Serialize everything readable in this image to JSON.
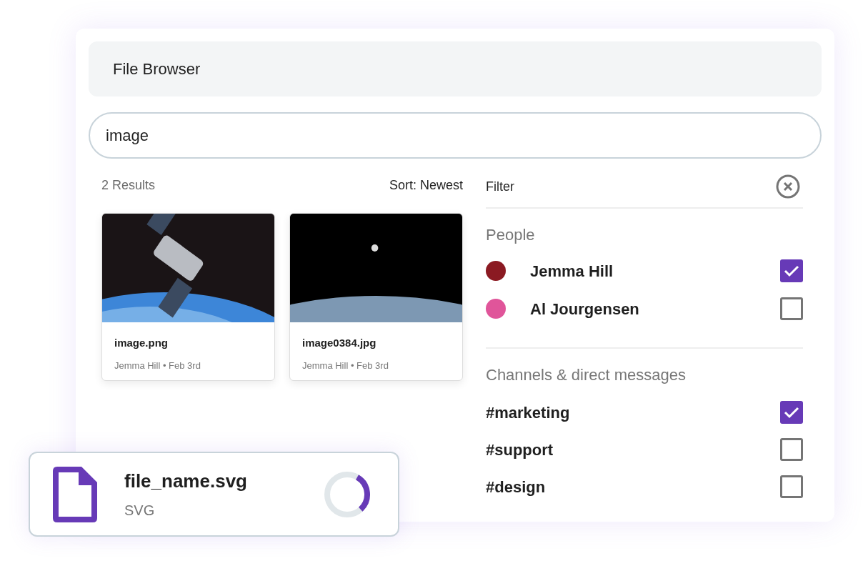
{
  "header": {
    "title": "File Browser"
  },
  "search": {
    "value": "image"
  },
  "results": {
    "count": "2 Results",
    "sort": "Sort: Newest",
    "files": [
      {
        "name": "image.png",
        "meta": "Jemma Hill • Feb 3rd",
        "kind": "satellite"
      },
      {
        "name": "image0384.jpg",
        "meta": "Jemma Hill • Feb 3rd",
        "kind": "astronaut"
      }
    ]
  },
  "filter": {
    "title": "Filter",
    "people": {
      "heading": "People",
      "items": [
        {
          "name": "Jemma Hill",
          "checked": true,
          "color": "#8b1a22"
        },
        {
          "name": "Al Jourgensen",
          "checked": false,
          "color": "#e0559a"
        }
      ]
    },
    "channels": {
      "heading": "Channels & direct messages",
      "items": [
        {
          "name": "#marketing",
          "checked": true
        },
        {
          "name": "#support",
          "checked": false
        },
        {
          "name": "#design",
          "checked": false
        }
      ]
    }
  },
  "upload": {
    "name": "file_name.svg",
    "type": "SVG",
    "level": 0.3
  }
}
